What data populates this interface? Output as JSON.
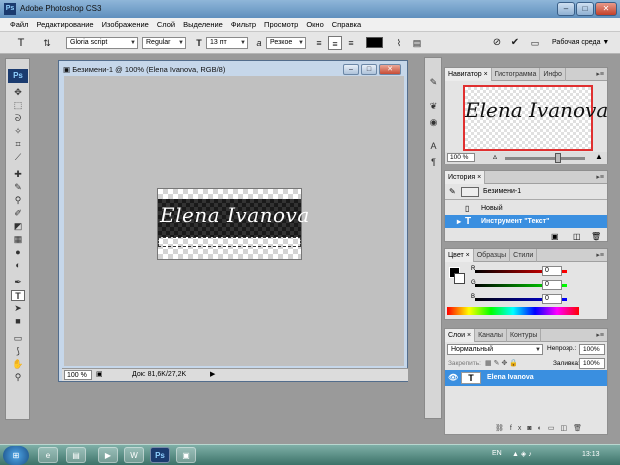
{
  "app": {
    "logo": "Ps",
    "title": "Adobe Photoshop CS3",
    "window_controls": [
      "minimize-icon",
      "maximize-icon",
      "close-icon"
    ]
  },
  "menu": [
    "Файл",
    "Редактирование",
    "Изображение",
    "Слой",
    "Выделение",
    "Фильтр",
    "Просмотр",
    "Окно",
    "Справка"
  ],
  "options": {
    "tool_glyph": "T",
    "font_family": "Gloria script",
    "font_style": "Regular",
    "font_size": "13 пт",
    "antialias_glyph": "a",
    "antialias": "Резкое",
    "text_color": "#000000",
    "workspace": "Рабочая среда"
  },
  "toolbox": {
    "logo": "Ps",
    "foreground_color": "#000000",
    "background_color": "#ffffff"
  },
  "document": {
    "title": "Безимени-1 @ 100% (Elena Ivanova, RGB/8)",
    "image_text": "Elena Ivanova",
    "zoom": "100 %",
    "doc_info": "Док: 81,6K/27,2K"
  },
  "navigator": {
    "tabs": [
      "Навигатор",
      "Гистограмма",
      "Инфо"
    ],
    "zoom": "100 %",
    "preview_text": "Elena Ivanova",
    "zoom_level": 0.66
  },
  "history": {
    "tabs": [
      "История"
    ],
    "snapshot_name": "Безимени-1",
    "items": [
      "Новый",
      "Инструмент \"Текст\""
    ],
    "selected_index": 1
  },
  "color": {
    "tabs": [
      "Цвет",
      "Образцы",
      "Стили"
    ],
    "channels": [
      {
        "label": "R",
        "value": "0",
        "color": "#e02020"
      },
      {
        "label": "G",
        "value": "0",
        "color": "#20a020"
      },
      {
        "label": "B",
        "value": "0",
        "color": "#2020e0"
      }
    ]
  },
  "layers": {
    "tabs": [
      "Слои",
      "Каналы",
      "Контуры"
    ],
    "blend_mode": "Нормальный",
    "opacity_label": "Непрозр.:",
    "opacity": "100%",
    "lock_label": "Закрепить:",
    "fill_label": "Заливка:",
    "fill": "100%",
    "layer_name": "Elena Ivanova",
    "layer_glyph": "T"
  },
  "taskbar": {
    "lang": "EN",
    "time": "13:13",
    "start_glyph": "⊞",
    "ps_label": "Ps"
  },
  "accent": "#3a8fe0"
}
